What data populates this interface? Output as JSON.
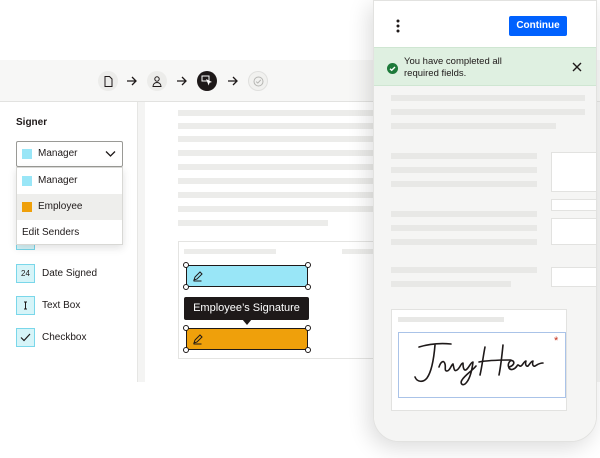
{
  "steps": [
    {
      "icon": "document-icon",
      "state": "done"
    },
    {
      "icon": "person-icon",
      "state": "done"
    },
    {
      "icon": "cursor-select-icon",
      "state": "active"
    },
    {
      "icon": "checkmark-icon",
      "state": "pending"
    }
  ],
  "sidebar": {
    "title": "Signer",
    "selected": {
      "label": "Manager",
      "color": "#99e6f7"
    },
    "menu": [
      {
        "label": "Manager",
        "color": "#99e6f7"
      },
      {
        "label": "Employee",
        "color": "#efa00b"
      },
      {
        "label": "Edit Senders"
      }
    ],
    "tools": [
      {
        "label": "Date Signed",
        "icon": "calendar-icon"
      },
      {
        "label": "Text Box",
        "icon": "text-cursor-icon"
      },
      {
        "label": "Checkbox",
        "icon": "checkbox-icon"
      }
    ]
  },
  "document": {
    "tooltip": "Employee’s Signature",
    "field_colors": {
      "manager": "#99e6f7",
      "employee": "#efa00b"
    }
  },
  "phone": {
    "continue_label": "Continue",
    "banner_message": "You have completed all required fields.",
    "required_marker": "*",
    "signature_image": "handwritten-signature"
  },
  "colors": {
    "accent": "#0061fe",
    "success": "#1d7a3a",
    "banner_bg": "#dff0e1"
  }
}
